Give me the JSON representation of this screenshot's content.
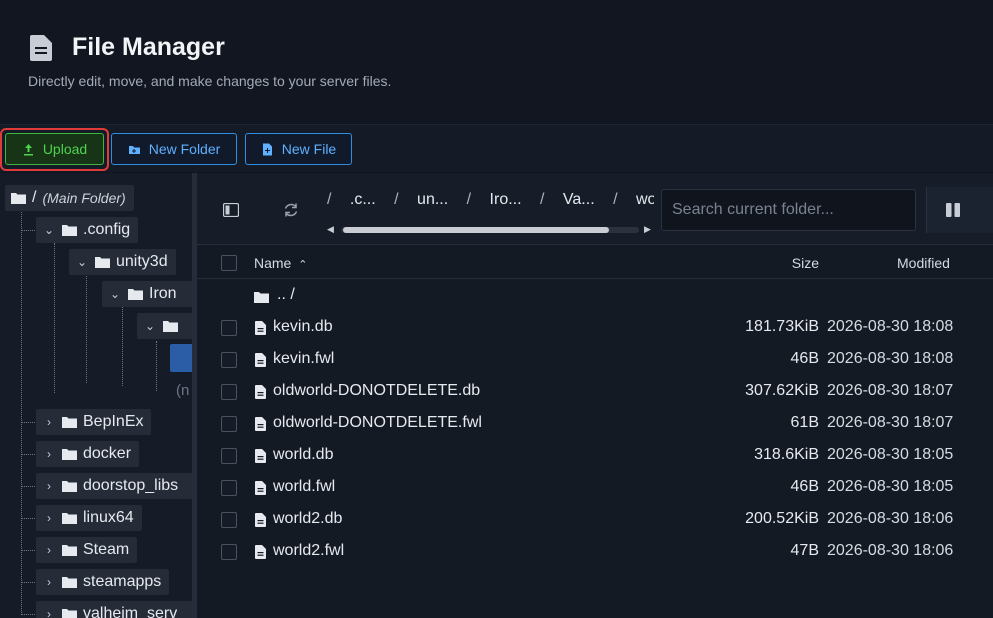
{
  "header": {
    "title": "File Manager",
    "subtitle": "Directly edit, move, and make changes to your server files."
  },
  "toolbar": {
    "upload_label": "Upload",
    "new_folder_label": "New Folder",
    "new_file_label": "New File"
  },
  "tree": {
    "root_label": "/",
    "root_note": "(Main Folder)",
    "config": ".config",
    "unity3d": "unity3d",
    "iron": "Iron",
    "truncated": "(n",
    "items": [
      "BepInEx",
      "docker",
      "doorstop_libs",
      "linux64",
      "Steam",
      "steamapps",
      "valheim_serv"
    ]
  },
  "nav": {
    "breadcrumbs": [
      "/",
      ".c...",
      "/",
      "un...",
      "/",
      "Iro...",
      "/",
      "Va...",
      "/",
      "worlds_l"
    ],
    "search_placeholder": "Search current folder..."
  },
  "table": {
    "col_name": "Name",
    "col_size": "Size",
    "col_modified": "Modified",
    "parent_label": ".. /",
    "rows": [
      {
        "name": "kevin.db",
        "size": "181.73KiB",
        "modified": "2026-08-30 18:08"
      },
      {
        "name": "kevin.fwl",
        "size": "46B",
        "modified": "2026-08-30 18:08"
      },
      {
        "name": "oldworld-DONOTDELETE.db",
        "size": "307.62KiB",
        "modified": "2026-08-30 18:07"
      },
      {
        "name": "oldworld-DONOTDELETE.fwl",
        "size": "61B",
        "modified": "2026-08-30 18:07"
      },
      {
        "name": "world.db",
        "size": "318.6KiB",
        "modified": "2026-08-30 18:05"
      },
      {
        "name": "world.fwl",
        "size": "46B",
        "modified": "2026-08-30 18:05"
      },
      {
        "name": "world2.db",
        "size": "200.52KiB",
        "modified": "2026-08-30 18:06"
      },
      {
        "name": "world2.fwl",
        "size": "47B",
        "modified": "2026-08-30 18:06"
      }
    ]
  },
  "colors": {
    "upload_green": "#4ed34e",
    "accent_blue": "#5fb0ff",
    "highlight_red": "#e03b3b",
    "selected_blue": "#2b5da6"
  }
}
